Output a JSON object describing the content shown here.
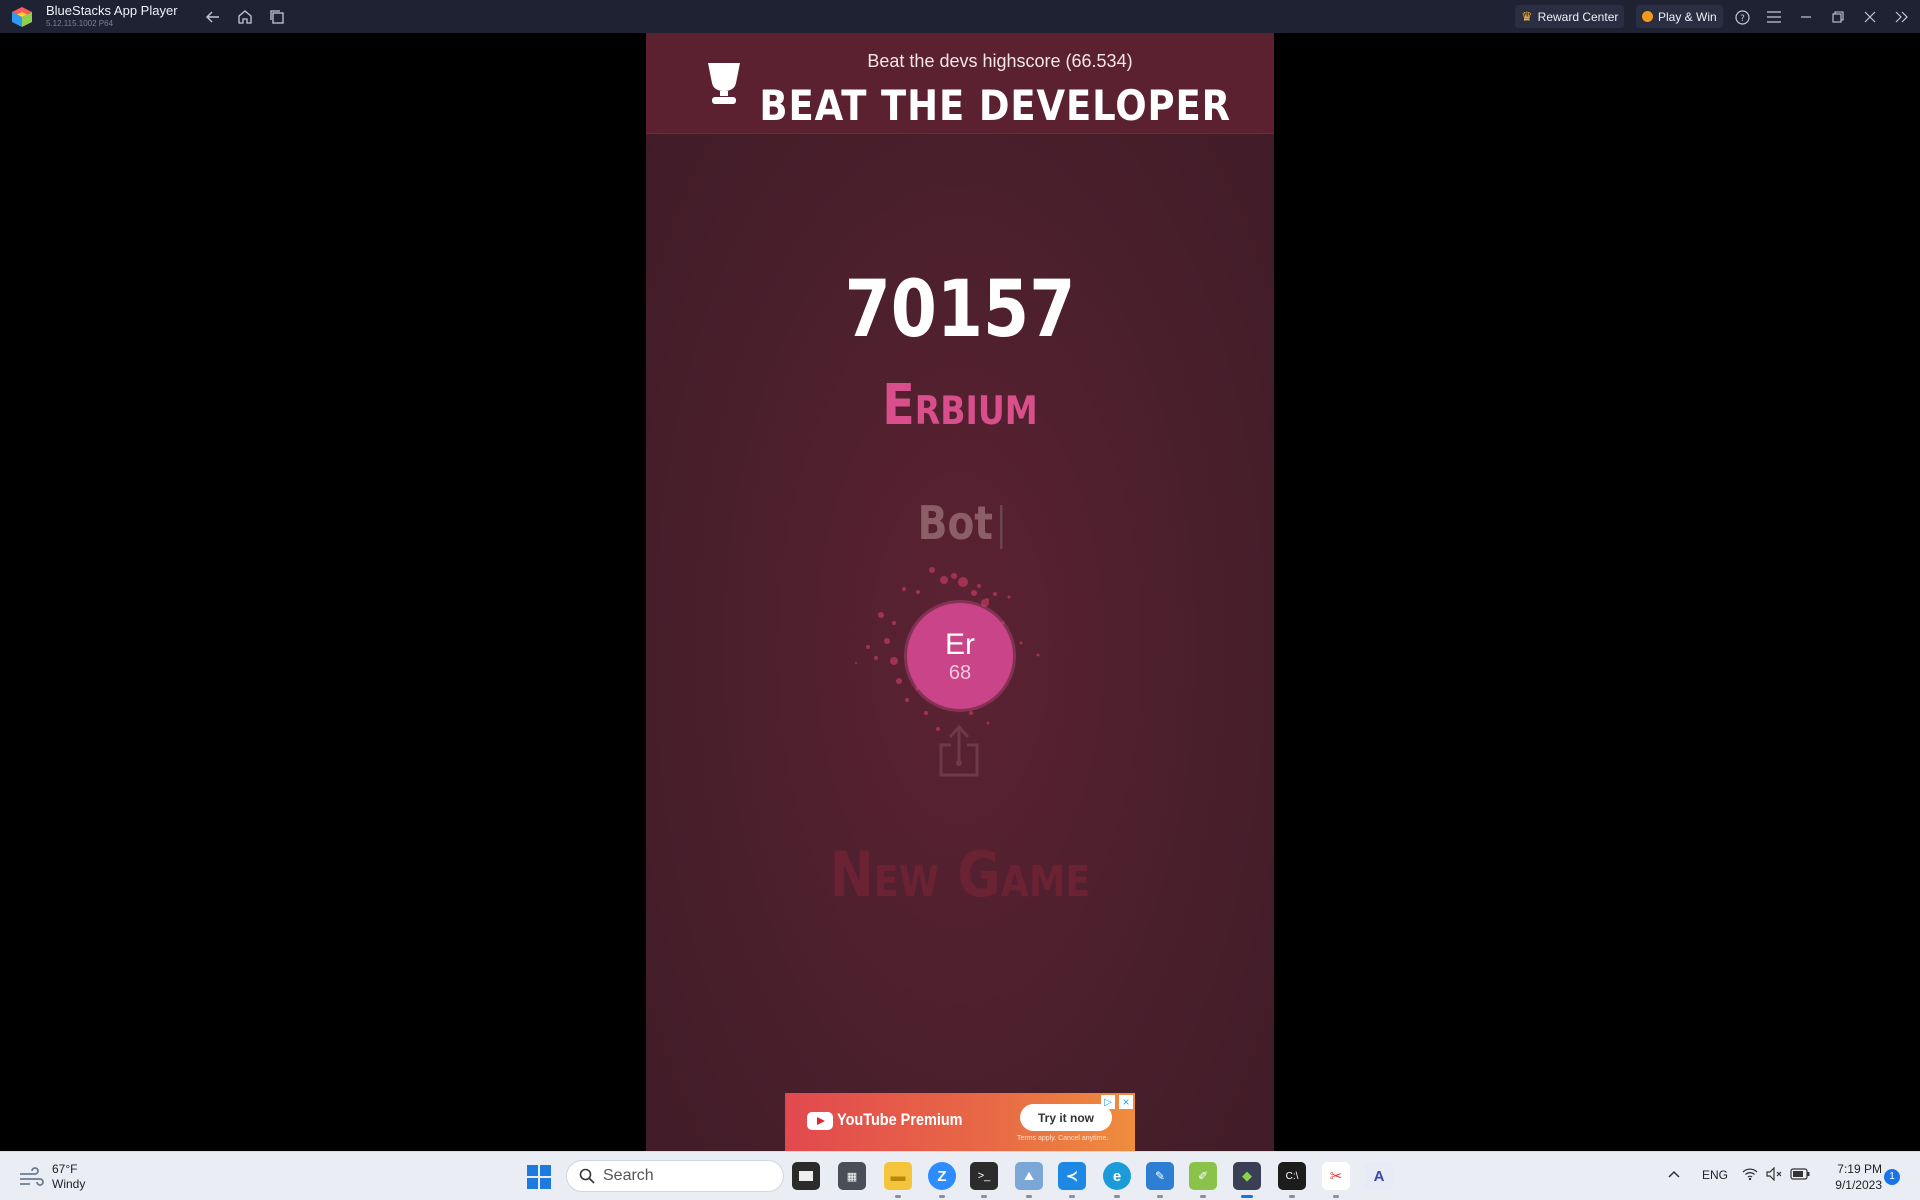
{
  "window": {
    "app_name": "BlueStacks App Player",
    "app_version": "5.12.115.1002  P64",
    "reward_center": "Reward Center",
    "play_win": "Play & Win"
  },
  "game": {
    "subtitle": "Beat the devs highscore (66.534)",
    "title": "BEAT THE DEVELOPER",
    "score": "70157",
    "element_name": "Erbium",
    "player_name": "Bot",
    "element_symbol": "Er",
    "element_number": "68",
    "new_game": "New Game",
    "colors": {
      "background": "#4a1f2c",
      "header": "#5b2130",
      "accent": "#d84f8c",
      "atom": "#c94488"
    }
  },
  "ad": {
    "brand": "YouTube Premium",
    "cta": "Try it now",
    "terms": "Terms apply. Cancel anytime."
  },
  "taskbar": {
    "weather_temp": "67°F",
    "weather_desc": "Windy",
    "search_placeholder": "Search",
    "language": "ENG",
    "time": "7:19 PM",
    "date": "9/1/2023",
    "notification_count": "1"
  }
}
